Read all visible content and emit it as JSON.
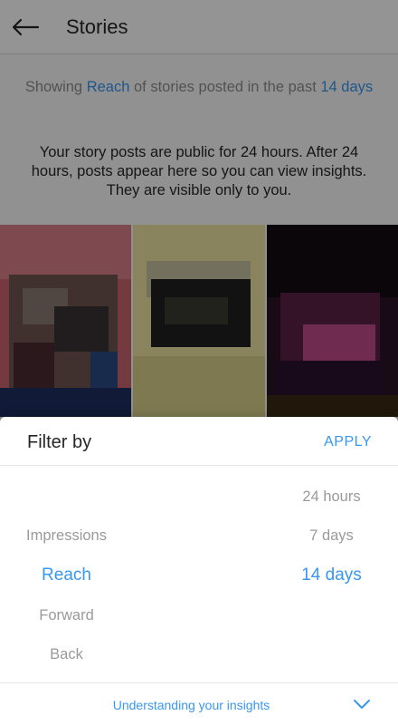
{
  "header": {
    "title": "Stories",
    "back_icon": "arrow-left-icon"
  },
  "info": {
    "line1_prefix": "Showing ",
    "line1_metric": "Reach",
    "line1_middle": " of stories posted in the past ",
    "line1_period": "14 days",
    "line2": "Your story posts are public for 24 hours. After 24 hours, posts appear here so you can view insights. They are visible only to you."
  },
  "thumbnails": [
    "story-thumbnail-1",
    "story-thumbnail-2",
    "story-thumbnail-3"
  ],
  "sheet": {
    "title": "Filter by",
    "apply_label": "APPLY",
    "metrics": [
      "Impressions",
      "Reach",
      "Forward",
      "Back"
    ],
    "metric_selected": "Reach",
    "periods": [
      "24 hours",
      "7 days",
      "14 days"
    ],
    "period_selected": "14 days",
    "footer_link": "Understanding your insights",
    "footer_icon": "chevron-down-icon"
  },
  "colors": {
    "accent": "#3897f0",
    "text": "#262626",
    "muted": "#8e8e8e"
  }
}
